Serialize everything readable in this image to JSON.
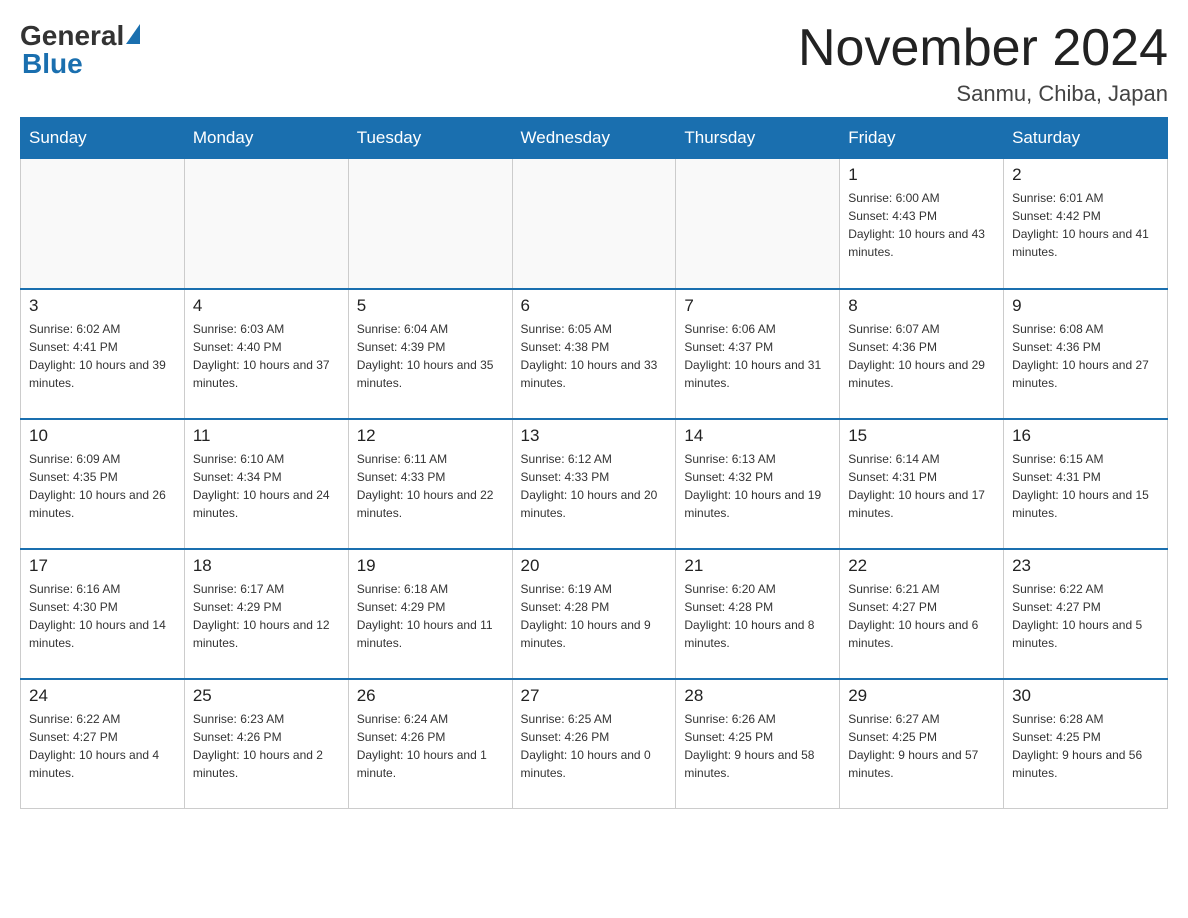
{
  "header": {
    "logo_general": "General",
    "logo_blue": "Blue",
    "month_title": "November 2024",
    "location": "Sanmu, Chiba, Japan"
  },
  "weekdays": [
    "Sunday",
    "Monday",
    "Tuesday",
    "Wednesday",
    "Thursday",
    "Friday",
    "Saturday"
  ],
  "weeks": [
    [
      {
        "day": "",
        "sunrise": "",
        "sunset": "",
        "daylight": ""
      },
      {
        "day": "",
        "sunrise": "",
        "sunset": "",
        "daylight": ""
      },
      {
        "day": "",
        "sunrise": "",
        "sunset": "",
        "daylight": ""
      },
      {
        "day": "",
        "sunrise": "",
        "sunset": "",
        "daylight": ""
      },
      {
        "day": "",
        "sunrise": "",
        "sunset": "",
        "daylight": ""
      },
      {
        "day": "1",
        "sunrise": "Sunrise: 6:00 AM",
        "sunset": "Sunset: 4:43 PM",
        "daylight": "Daylight: 10 hours and 43 minutes."
      },
      {
        "day": "2",
        "sunrise": "Sunrise: 6:01 AM",
        "sunset": "Sunset: 4:42 PM",
        "daylight": "Daylight: 10 hours and 41 minutes."
      }
    ],
    [
      {
        "day": "3",
        "sunrise": "Sunrise: 6:02 AM",
        "sunset": "Sunset: 4:41 PM",
        "daylight": "Daylight: 10 hours and 39 minutes."
      },
      {
        "day": "4",
        "sunrise": "Sunrise: 6:03 AM",
        "sunset": "Sunset: 4:40 PM",
        "daylight": "Daylight: 10 hours and 37 minutes."
      },
      {
        "day": "5",
        "sunrise": "Sunrise: 6:04 AM",
        "sunset": "Sunset: 4:39 PM",
        "daylight": "Daylight: 10 hours and 35 minutes."
      },
      {
        "day": "6",
        "sunrise": "Sunrise: 6:05 AM",
        "sunset": "Sunset: 4:38 PM",
        "daylight": "Daylight: 10 hours and 33 minutes."
      },
      {
        "day": "7",
        "sunrise": "Sunrise: 6:06 AM",
        "sunset": "Sunset: 4:37 PM",
        "daylight": "Daylight: 10 hours and 31 minutes."
      },
      {
        "day": "8",
        "sunrise": "Sunrise: 6:07 AM",
        "sunset": "Sunset: 4:36 PM",
        "daylight": "Daylight: 10 hours and 29 minutes."
      },
      {
        "day": "9",
        "sunrise": "Sunrise: 6:08 AM",
        "sunset": "Sunset: 4:36 PM",
        "daylight": "Daylight: 10 hours and 27 minutes."
      }
    ],
    [
      {
        "day": "10",
        "sunrise": "Sunrise: 6:09 AM",
        "sunset": "Sunset: 4:35 PM",
        "daylight": "Daylight: 10 hours and 26 minutes."
      },
      {
        "day": "11",
        "sunrise": "Sunrise: 6:10 AM",
        "sunset": "Sunset: 4:34 PM",
        "daylight": "Daylight: 10 hours and 24 minutes."
      },
      {
        "day": "12",
        "sunrise": "Sunrise: 6:11 AM",
        "sunset": "Sunset: 4:33 PM",
        "daylight": "Daylight: 10 hours and 22 minutes."
      },
      {
        "day": "13",
        "sunrise": "Sunrise: 6:12 AM",
        "sunset": "Sunset: 4:33 PM",
        "daylight": "Daylight: 10 hours and 20 minutes."
      },
      {
        "day": "14",
        "sunrise": "Sunrise: 6:13 AM",
        "sunset": "Sunset: 4:32 PM",
        "daylight": "Daylight: 10 hours and 19 minutes."
      },
      {
        "day": "15",
        "sunrise": "Sunrise: 6:14 AM",
        "sunset": "Sunset: 4:31 PM",
        "daylight": "Daylight: 10 hours and 17 minutes."
      },
      {
        "day": "16",
        "sunrise": "Sunrise: 6:15 AM",
        "sunset": "Sunset: 4:31 PM",
        "daylight": "Daylight: 10 hours and 15 minutes."
      }
    ],
    [
      {
        "day": "17",
        "sunrise": "Sunrise: 6:16 AM",
        "sunset": "Sunset: 4:30 PM",
        "daylight": "Daylight: 10 hours and 14 minutes."
      },
      {
        "day": "18",
        "sunrise": "Sunrise: 6:17 AM",
        "sunset": "Sunset: 4:29 PM",
        "daylight": "Daylight: 10 hours and 12 minutes."
      },
      {
        "day": "19",
        "sunrise": "Sunrise: 6:18 AM",
        "sunset": "Sunset: 4:29 PM",
        "daylight": "Daylight: 10 hours and 11 minutes."
      },
      {
        "day": "20",
        "sunrise": "Sunrise: 6:19 AM",
        "sunset": "Sunset: 4:28 PM",
        "daylight": "Daylight: 10 hours and 9 minutes."
      },
      {
        "day": "21",
        "sunrise": "Sunrise: 6:20 AM",
        "sunset": "Sunset: 4:28 PM",
        "daylight": "Daylight: 10 hours and 8 minutes."
      },
      {
        "day": "22",
        "sunrise": "Sunrise: 6:21 AM",
        "sunset": "Sunset: 4:27 PM",
        "daylight": "Daylight: 10 hours and 6 minutes."
      },
      {
        "day": "23",
        "sunrise": "Sunrise: 6:22 AM",
        "sunset": "Sunset: 4:27 PM",
        "daylight": "Daylight: 10 hours and 5 minutes."
      }
    ],
    [
      {
        "day": "24",
        "sunrise": "Sunrise: 6:22 AM",
        "sunset": "Sunset: 4:27 PM",
        "daylight": "Daylight: 10 hours and 4 minutes."
      },
      {
        "day": "25",
        "sunrise": "Sunrise: 6:23 AM",
        "sunset": "Sunset: 4:26 PM",
        "daylight": "Daylight: 10 hours and 2 minutes."
      },
      {
        "day": "26",
        "sunrise": "Sunrise: 6:24 AM",
        "sunset": "Sunset: 4:26 PM",
        "daylight": "Daylight: 10 hours and 1 minute."
      },
      {
        "day": "27",
        "sunrise": "Sunrise: 6:25 AM",
        "sunset": "Sunset: 4:26 PM",
        "daylight": "Daylight: 10 hours and 0 minutes."
      },
      {
        "day": "28",
        "sunrise": "Sunrise: 6:26 AM",
        "sunset": "Sunset: 4:25 PM",
        "daylight": "Daylight: 9 hours and 58 minutes."
      },
      {
        "day": "29",
        "sunrise": "Sunrise: 6:27 AM",
        "sunset": "Sunset: 4:25 PM",
        "daylight": "Daylight: 9 hours and 57 minutes."
      },
      {
        "day": "30",
        "sunrise": "Sunrise: 6:28 AM",
        "sunset": "Sunset: 4:25 PM",
        "daylight": "Daylight: 9 hours and 56 minutes."
      }
    ]
  ]
}
